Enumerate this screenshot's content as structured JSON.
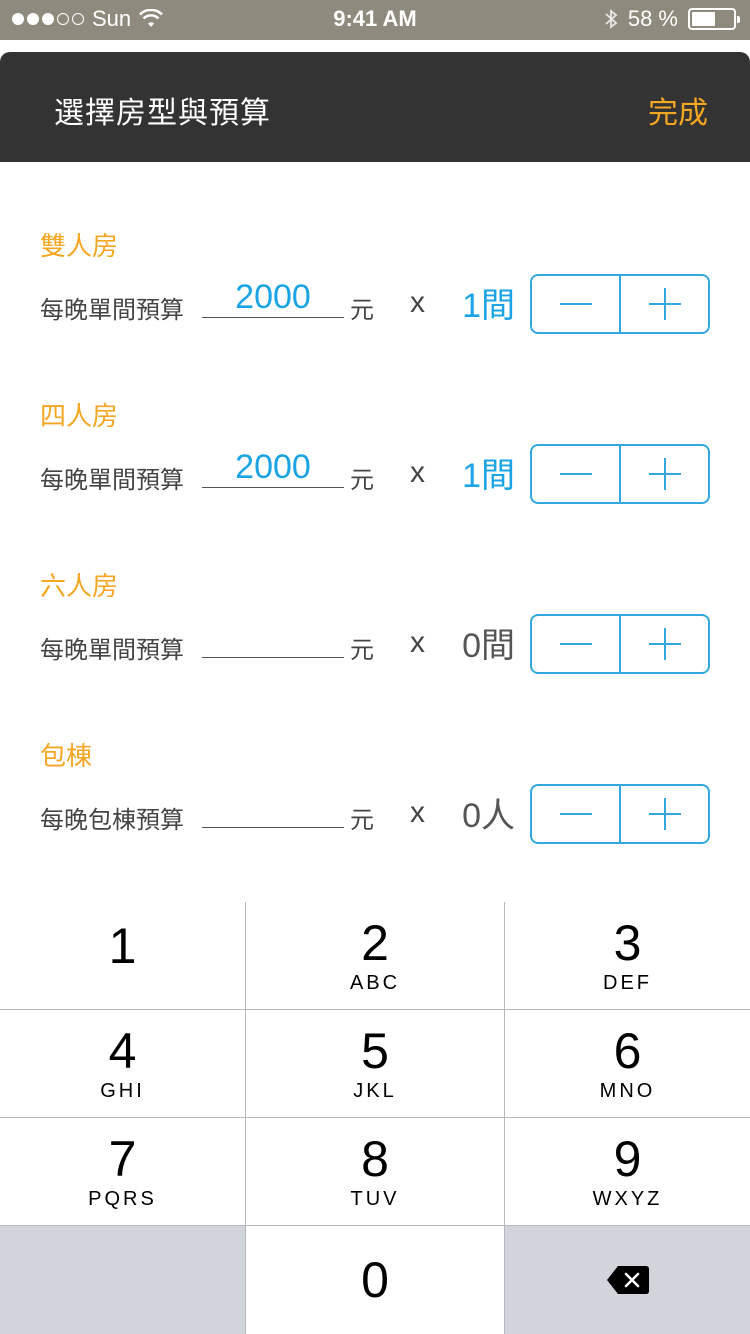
{
  "status_bar": {
    "carrier": "Sun",
    "time": "9:41 AM",
    "battery_percent": "58 %",
    "battery_level": 0.58,
    "signal_dots_filled": 3,
    "signal_dots_total": 5
  },
  "header": {
    "title": "選擇房型與預算",
    "done_label": "完成"
  },
  "rooms": [
    {
      "name": "雙人房",
      "budget_label": "每晚單間預算",
      "budget_value": "2000",
      "unit": "元",
      "times": "x",
      "count": "1間",
      "active": true
    },
    {
      "name": "四人房",
      "budget_label": "每晚單間預算",
      "budget_value": "2000",
      "unit": "元",
      "times": "x",
      "count": "1間",
      "active": true
    },
    {
      "name": "六人房",
      "budget_label": "每晚單間預算",
      "budget_value": "",
      "unit": "元",
      "times": "x",
      "count": "0間",
      "active": false
    },
    {
      "name": "包棟",
      "budget_label": "每晚包棟預算",
      "budget_value": "",
      "unit": "元",
      "times": "x",
      "count": "0人",
      "active": false
    }
  ],
  "keypad": {
    "keys": [
      {
        "digit": "1",
        "letters": ""
      },
      {
        "digit": "2",
        "letters": "ABC"
      },
      {
        "digit": "3",
        "letters": "DEF"
      },
      {
        "digit": "4",
        "letters": "GHI"
      },
      {
        "digit": "5",
        "letters": "JKL"
      },
      {
        "digit": "6",
        "letters": "MNO"
      },
      {
        "digit": "7",
        "letters": "PQRS"
      },
      {
        "digit": "8",
        "letters": "TUV"
      },
      {
        "digit": "9",
        "letters": "WXYZ"
      },
      {
        "digit": "0",
        "letters": ""
      }
    ]
  },
  "colors": {
    "accent_orange": "#f5a623",
    "accent_blue": "#1aa4e5",
    "header_bg": "#333333",
    "status_bg": "#8e8b7e"
  }
}
